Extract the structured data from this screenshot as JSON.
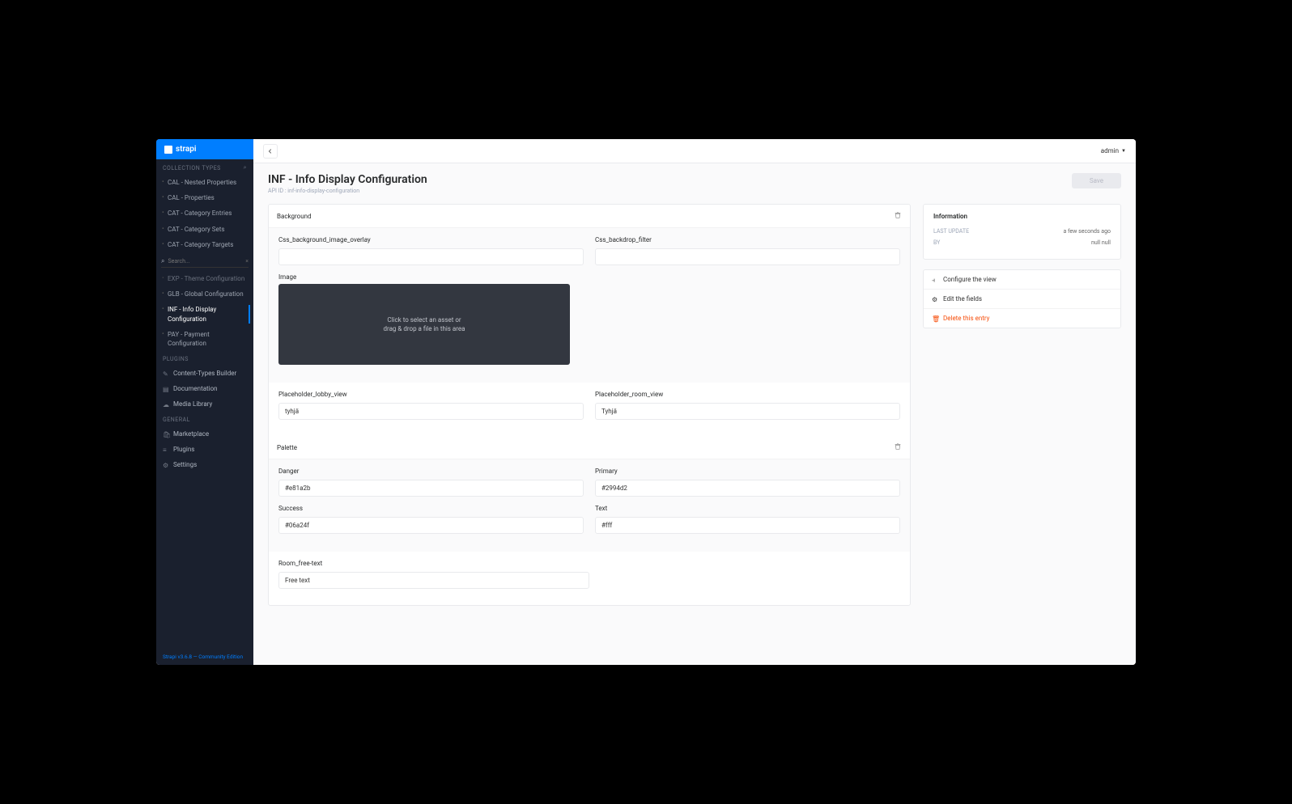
{
  "brand": "strapi",
  "topbar": {
    "user": "admin"
  },
  "sidebar": {
    "collection_header": "COLLECTION TYPES",
    "items": [
      {
        "label": "CAL - Nested Properties"
      },
      {
        "label": "CAL - Properties"
      },
      {
        "label": "CAT - Category Entries"
      },
      {
        "label": "CAT - Category Sets"
      },
      {
        "label": "CAT - Category Targets"
      }
    ],
    "search_placeholder": "Search...",
    "items2": [
      {
        "label": "EXP - Theme Configuration"
      },
      {
        "label": "GLB - Global Configuration"
      },
      {
        "label": "INF - Info Display Configuration",
        "active": true
      },
      {
        "label": "PAY - Payment Configuration"
      }
    ],
    "plugins_header": "PLUGINS",
    "plugins": [
      {
        "label": "Content-Types Builder"
      },
      {
        "label": "Documentation"
      },
      {
        "label": "Media Library"
      }
    ],
    "general_header": "GENERAL",
    "general": [
      {
        "label": "Marketplace"
      },
      {
        "label": "Plugins"
      },
      {
        "label": "Settings"
      }
    ],
    "footer": "Strapi v3.6.8 — Community Edition"
  },
  "page": {
    "title": "INF - Info Display Configuration",
    "api_id_label": "API ID ",
    "api_id": ": inf-info-display-configuration",
    "save": "Save"
  },
  "form": {
    "background": {
      "title": "Background",
      "css_overlay_label": "Css_background_image_overlay",
      "css_overlay_value": "",
      "css_backdrop_label": "Css_backdrop_filter",
      "css_backdrop_value": "",
      "image_label": "Image",
      "dropzone_line1": "Click to select an asset or",
      "dropzone_line2": "drag & drop a file in this area"
    },
    "placeholder_lobby_label": "Placeholder_lobby_view",
    "placeholder_lobby_value": "tyhjä",
    "placeholder_room_label": "Placeholder_room_view",
    "placeholder_room_value": "Tyhjä",
    "palette": {
      "title": "Palette",
      "danger_label": "Danger",
      "danger_value": "#e81a2b",
      "primary_label": "Primary",
      "primary_value": "#2994d2",
      "success_label": "Success",
      "success_value": "#06a24f",
      "text_label": "Text",
      "text_value": "#fff"
    },
    "room_free_label": "Room_free-text",
    "room_free_value": "Free text"
  },
  "info": {
    "title": "Information",
    "last_update_label": "LAST UPDATE",
    "last_update_value": "a few seconds ago",
    "by_label": "BY",
    "by_value": "null null"
  },
  "actions": {
    "configure": "Configure the view",
    "edit": "Edit the fields",
    "delete": "Delete this entry"
  }
}
